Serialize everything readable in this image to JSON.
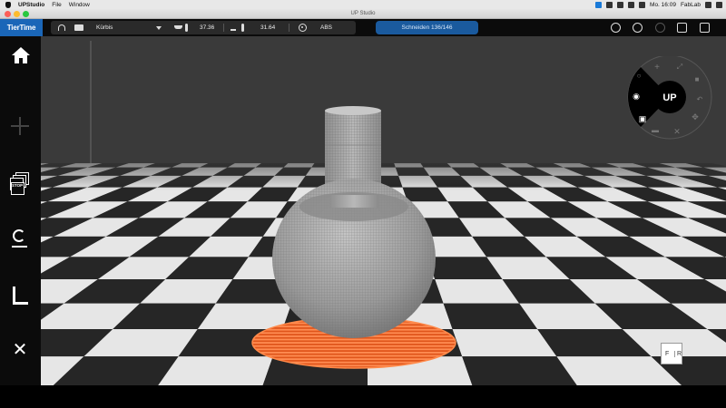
{
  "menubar": {
    "app": "UPStudio",
    "items": [
      "File",
      "Window"
    ],
    "clock": "Mo. 16:09",
    "user": "FabLab"
  },
  "window": {
    "title": "UP Studio"
  },
  "toolbar": {
    "brand": "TierTime",
    "material_profile": "Kürbis",
    "nozzle_temp": "37.36",
    "bed_temp": "31.64",
    "material": "ABS",
    "progress_text": "Schneiden 136/146",
    "progress_fraction": 0.93
  },
  "navwheel": {
    "center_label": "UP"
  },
  "viewcube": {
    "front": "F",
    "right": "R"
  },
  "colors": {
    "accent": "#1a66b8",
    "progress": "#1a5a9e",
    "raft": "#ff6a2a",
    "model": "#a9a9a9"
  }
}
